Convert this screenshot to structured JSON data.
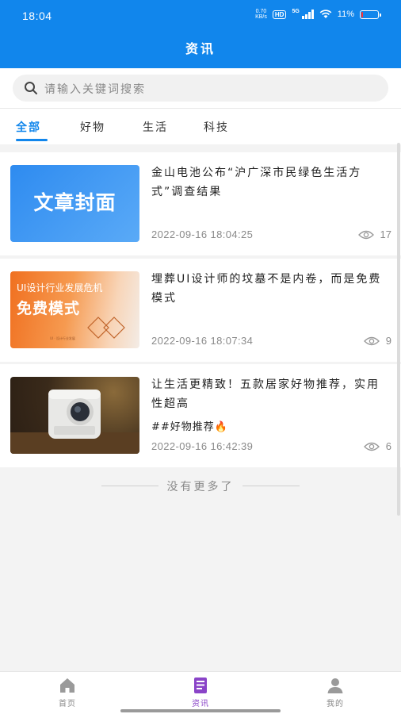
{
  "status_bar": {
    "time": "18:04",
    "net_speed_value": "0.70",
    "net_speed_unit": "KB/s",
    "hd_badge": "HD",
    "network": "5G",
    "battery_percent": "11%",
    "battery_level": 0.11,
    "battery_color": "#ff3333"
  },
  "header": {
    "title": "资讯",
    "bg_color": "#1186ec"
  },
  "search": {
    "placeholder": "请输入关键词搜索",
    "icon": "search-icon"
  },
  "tabs": [
    {
      "label": "全部",
      "active": true
    },
    {
      "label": "好物",
      "active": false
    },
    {
      "label": "生活",
      "active": false
    },
    {
      "label": "科技",
      "active": false
    }
  ],
  "articles": [
    {
      "title": "金山电池公布“沪广深市民绿色生活方式”调查结果",
      "date": "2022-09-16  18:04:25",
      "views": "17",
      "thumb_text": "文章封面"
    },
    {
      "title": "埋葬UI设计师的坟墓不是内卷，而是免费模式",
      "date": "2022-09-16  18:07:34",
      "views": "9",
      "thumb_line1": "UI设计行业发展危机",
      "thumb_line2": "免费模式",
      "thumb_line3": "UI · 设计行业发展"
    },
    {
      "title": "让生活更精致！五款居家好物推荐，实用性超高",
      "tag": "##好物推荐🔥",
      "date": "2022-09-16  16:42:39",
      "views": "6"
    }
  ],
  "list_footer": "没有更多了",
  "tabbar": {
    "items": [
      {
        "label": "首页",
        "icon": "home-icon",
        "active": false
      },
      {
        "label": "资讯",
        "icon": "news-icon",
        "active": true
      },
      {
        "label": "我的",
        "icon": "profile-icon",
        "active": false
      }
    ],
    "active_color": "#8a44c8"
  }
}
